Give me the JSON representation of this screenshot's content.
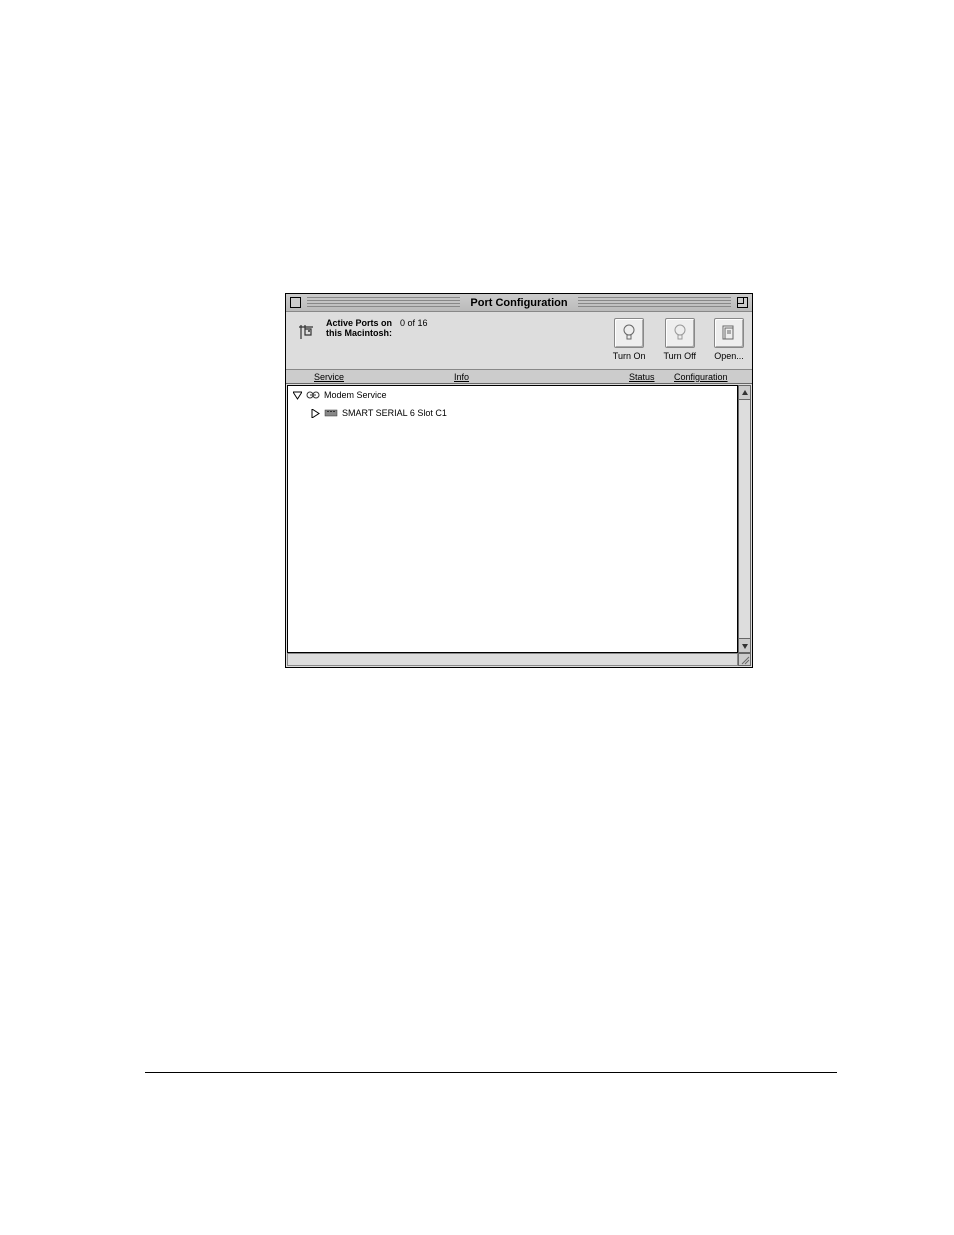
{
  "window": {
    "title": "Port Configuration",
    "activePortsLabel1": "Active Ports on",
    "activePortsLabel2": "this Macintosh:",
    "activePortsCount": "0  of  16",
    "toolbar": {
      "turnOn": "Turn On",
      "turnOff": "Turn Off",
      "open": "Open..."
    },
    "columns": {
      "service": "Service",
      "info": "Info",
      "status": "Status",
      "configuration": "Configuration"
    },
    "rows": [
      {
        "disclosure": "open",
        "icon": "modem",
        "label": "Modem Service"
      },
      {
        "disclosure": "closed",
        "icon": "card",
        "label": "SMART SERIAL 6 Slot C1",
        "indent": true
      }
    ]
  }
}
